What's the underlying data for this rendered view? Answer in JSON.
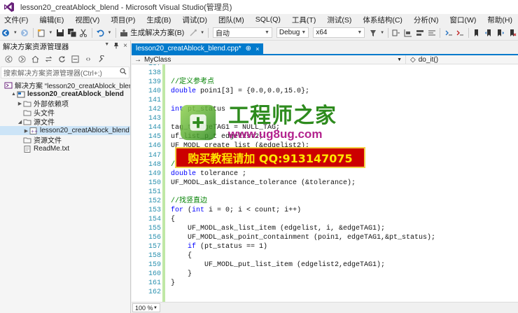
{
  "window": {
    "title": "lesson20_creatAblock_blend - Microsoft Visual Studio(管理员)"
  },
  "menu": [
    "文件(F)",
    "编辑(E)",
    "视图(V)",
    "项目(P)",
    "生成(B)",
    "调试(D)",
    "团队(M)",
    "SQL(Q)",
    "工具(T)",
    "测试(S)",
    "体系结构(C)",
    "分析(N)",
    "窗口(W)",
    "帮助(H)"
  ],
  "toolbar": {
    "build_solution_label": "生成解决方案(B)",
    "search_combo": "自动",
    "config_combo": "Debug",
    "platform_combo": "x64"
  },
  "solution_explorer": {
    "title": "解决方案资源管理器",
    "search_placeholder": "搜索解决方案资源管理器(Ctrl+;)",
    "items": [
      {
        "label": "解决方案 “lesson20_creatAblock_blend",
        "indent": 0,
        "expander": "",
        "icon": "solution-icon"
      },
      {
        "label": "lesson20_creatAblock_blend",
        "indent": 1,
        "expander": "▲",
        "icon": "project-icon",
        "bold": true
      },
      {
        "label": "外部依赖项",
        "indent": 2,
        "expander": "▶",
        "icon": "folder-icon"
      },
      {
        "label": "头文件",
        "indent": 2,
        "expander": "",
        "icon": "folder-icon"
      },
      {
        "label": "源文件",
        "indent": 2,
        "expander": "◢",
        "icon": "folder-icon"
      },
      {
        "label": "lesson20_creatAblock_blend",
        "indent": 3,
        "expander": "▶",
        "icon": "cpp-file-icon",
        "selected": true
      },
      {
        "label": "资源文件",
        "indent": 2,
        "expander": "",
        "icon": "folder-icon"
      },
      {
        "label": "ReadMe.txt",
        "indent": 2,
        "expander": "",
        "icon": "text-file-icon"
      }
    ]
  },
  "editor": {
    "tab_label": "lesson20_creatAblock_blend.cpp*",
    "tab_pin": "⊕",
    "tab_close": "×",
    "class_dropdown": "MyClass",
    "member_dropdown": "do_it()",
    "zoom": "100 %",
    "lines": [
      {
        "n": "137",
        "text": "",
        "cls": ""
      },
      {
        "n": "138",
        "text": "",
        "cls": ""
      },
      {
        "n": "139",
        "text": "//定义参考点",
        "cls": "cm"
      },
      {
        "n": "140",
        "text": "double poin1[3] = {0.0,0.0,15.0};",
        "cls": "mix_double"
      },
      {
        "n": "141",
        "text": "",
        "cls": ""
      },
      {
        "n": "142",
        "text": "int pt_status",
        "cls": "mix_int"
      },
      {
        "n": "143",
        "text": "",
        "cls": ""
      },
      {
        "n": "144",
        "text": "tag_t edgeTAG1 = NULL_TAG;",
        "cls": ""
      },
      {
        "n": "145",
        "text": "uf_list_p_t edgelist2;",
        "cls": ""
      },
      {
        "n": "146",
        "text": "UF_MODL_create_list (&edgelist2);",
        "cls": ""
      },
      {
        "n": "147",
        "text": "",
        "cls": ""
      },
      {
        "n": "148",
        "text": "//获取建模公差",
        "cls": "cm"
      },
      {
        "n": "149",
        "text": "double tolerance ;",
        "cls": "mix_double"
      },
      {
        "n": "150",
        "text": "UF_MODL_ask_distance_tolerance (&tolerance);",
        "cls": ""
      },
      {
        "n": "151",
        "text": "",
        "cls": ""
      },
      {
        "n": "152",
        "text": "//找竖直边",
        "cls": "cm"
      },
      {
        "n": "153",
        "text": "for (int i = 0; i < count; i++)",
        "cls": "mix_for"
      },
      {
        "n": "154",
        "text": "{",
        "cls": ""
      },
      {
        "n": "155",
        "text": "    UF_MODL_ask_list_item (edgelist, i, &edgeTAG1);",
        "cls": ""
      },
      {
        "n": "156",
        "text": "    UF_MODL_ask_point_containment (poin1, edgeTAG1,&pt_status);",
        "cls": ""
      },
      {
        "n": "157",
        "text": "    if (pt_status == 1)",
        "cls": "mix_if"
      },
      {
        "n": "158",
        "text": "    {",
        "cls": ""
      },
      {
        "n": "159",
        "text": "        UF_MODL_put_list_item (edgelist2,edgeTAG1);",
        "cls": ""
      },
      {
        "n": "160",
        "text": "    }",
        "cls": ""
      },
      {
        "n": "161",
        "text": "}",
        "cls": ""
      },
      {
        "n": "162",
        "text": "",
        "cls": ""
      }
    ]
  },
  "watermark": {
    "title": "工程师之家",
    "url": "www.ug8ug.com",
    "banner": "购买教程请加 QQ:913147075"
  },
  "colors": {
    "accent": "#007acc",
    "keyword": "#0000ff",
    "comment": "#008000",
    "line_number": "#2b91af",
    "change_bar": "#c0e8a6"
  }
}
